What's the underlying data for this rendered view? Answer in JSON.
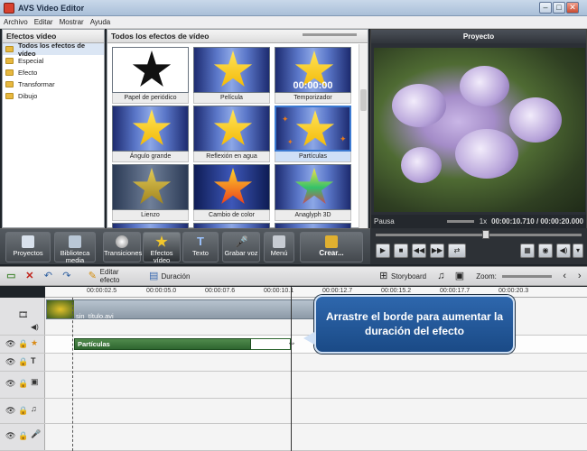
{
  "window": {
    "title": "AVS Video Editor",
    "min": "–",
    "max": "□",
    "close": "✕"
  },
  "menu": [
    "Archivo",
    "Editar",
    "Mostrar",
    "Ayuda"
  ],
  "left_panel": {
    "title": "Efectos vídeo",
    "items": [
      "Todos los efectos de vídeo",
      "Especial",
      "Efecto",
      "Transformar",
      "Dibujo"
    ]
  },
  "effects_panel": {
    "title": "Todos los efectos de vídeo",
    "tiles": [
      "Papel de periódico",
      "Película",
      "Temporizador",
      "Ángulo grande",
      "Reflexión en agua",
      "Partículas",
      "Lienzo",
      "Cambio de color",
      "Anaglyph 3D"
    ],
    "timer_text": "00:00:00"
  },
  "preview": {
    "title": "Proyecto",
    "status": "Pausa",
    "speed": "1x",
    "time": "00:00:10.710 / 00:00:20.000"
  },
  "toolbar": [
    "Proyectos",
    "Biblioteca media",
    "Transiciones",
    "Efectos vídeo",
    "Texto",
    "Grabar voz",
    "Menú",
    "Crear..."
  ],
  "player_buttons": [
    "▶",
    "■",
    "◀◀",
    "▶▶",
    "⇄"
  ],
  "player_right": [
    "▦",
    "◉",
    "◀)",
    "▾"
  ],
  "timeline_toolbar": {
    "edit_effect": "Editar efecto",
    "duration": "Duración",
    "storyboard": "Storyboard",
    "zoom": "Zoom:"
  },
  "ruler": [
    "00:00:02.5",
    "00:00:05.0",
    "00:00:07.6",
    "00:00:10.1",
    "00:00:12.7",
    "00:00:15.2",
    "00:00:17.7",
    "00:00:20.3"
  ],
  "clips": {
    "video": "sin_título.avi",
    "effect": "Partículas"
  },
  "tooltip": "Arrastre el borde para aumentar la duración del efecto"
}
